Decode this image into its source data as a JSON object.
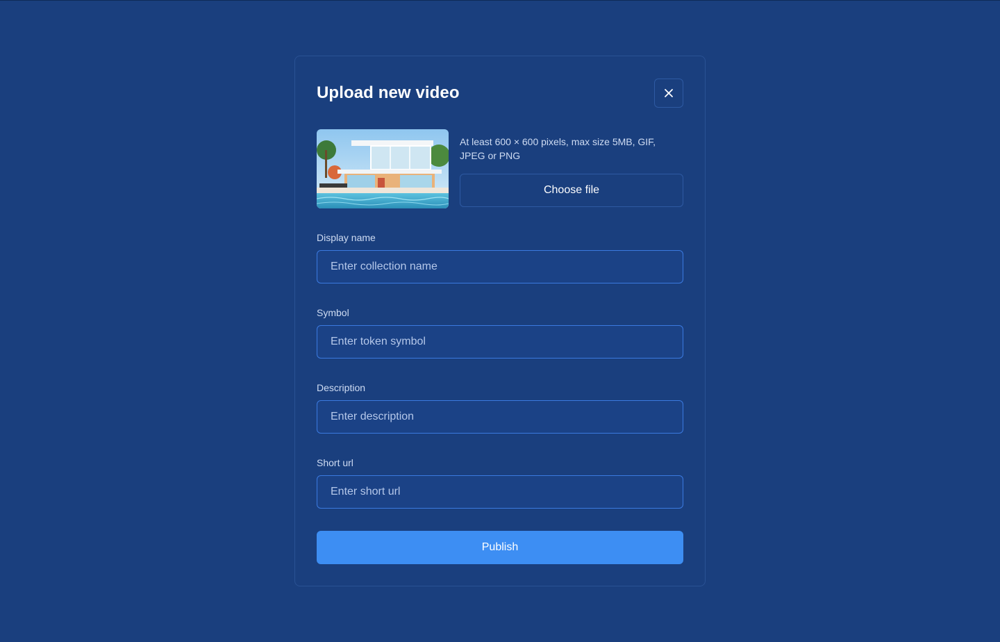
{
  "modal": {
    "title": "Upload new video",
    "close_icon": "close-icon"
  },
  "upload": {
    "thumbnail_icon": "house-photo",
    "hint": "At least 600 × 600 pixels, max size 5MB, GIF, JPEG or PNG",
    "choose_file_label": "Choose file"
  },
  "fields": {
    "display_name": {
      "label": "Display name",
      "placeholder": "Enter collection name",
      "value": ""
    },
    "symbol": {
      "label": "Symbol",
      "placeholder": "Enter token symbol",
      "value": ""
    },
    "description": {
      "label": "Description",
      "placeholder": "Enter description",
      "value": ""
    },
    "short_url": {
      "label": "Short url",
      "placeholder": "Enter short url",
      "value": ""
    }
  },
  "actions": {
    "publish_label": "Publish"
  },
  "colors": {
    "background": "#1a3f7e",
    "accent": "#3d8ef3",
    "input_border": "#3b7ae0"
  }
}
